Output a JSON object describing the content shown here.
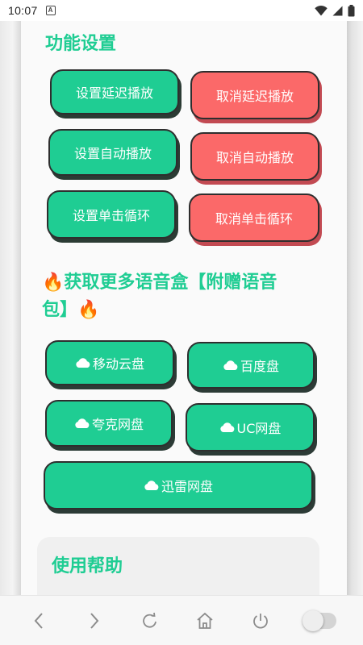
{
  "status_bar": {
    "time": "10:07",
    "notification_badge": "A"
  },
  "settings": {
    "title": "功能设置",
    "buttons": [
      {
        "label": "设置延迟播放",
        "color": "#1fcd93"
      },
      {
        "label": "取消延迟播放",
        "color": "#fb6969"
      },
      {
        "label": "设置自动播放",
        "color": "#1fcd93"
      },
      {
        "label": "取消自动播放",
        "color": "#fb6969"
      },
      {
        "label": "设置单击循环",
        "color": "#1fcd93"
      },
      {
        "label": "取消单击循环",
        "color": "#fb6969"
      }
    ]
  },
  "voicebox": {
    "title_line1": "🔥获取更多语音盒【附赠语音",
    "title_line2": "包】🔥",
    "buttons": [
      {
        "label": "移动云盘",
        "icon": "cloud-icon"
      },
      {
        "label": "百度盘",
        "icon": "cloud-icon"
      },
      {
        "label": "夸克网盘",
        "icon": "cloud-icon"
      },
      {
        "label": "UC网盘",
        "icon": "cloud-icon"
      },
      {
        "label": "迅雷网盘",
        "icon": "cloud-icon"
      }
    ]
  },
  "help": {
    "title": "使用帮助"
  },
  "nav": {
    "items": [
      "back-icon",
      "forward-icon",
      "refresh-icon",
      "home-icon",
      "power-icon",
      "toggle-switch"
    ],
    "toggle_on": false
  },
  "colors": {
    "accent": "#1fcd93",
    "danger": "#fb6969",
    "border": "#2e2e2e"
  }
}
